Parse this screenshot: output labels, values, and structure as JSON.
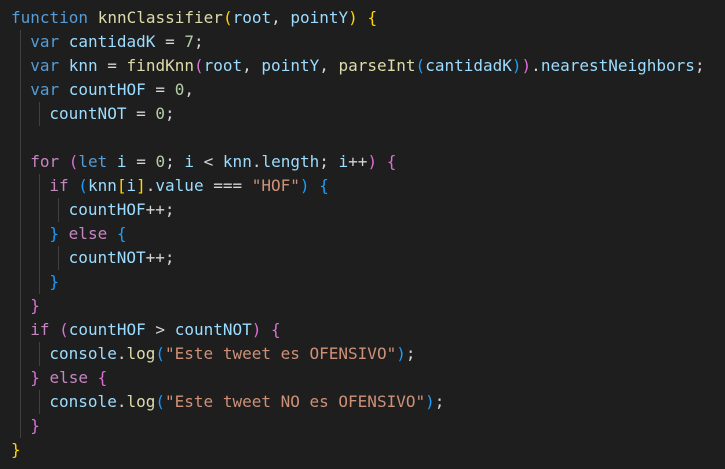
{
  "editor": {
    "language": "javascript",
    "theme_background": "#1e1e1e",
    "colors": {
      "keyword": "#569cd6",
      "control": "#c586c0",
      "function": "#dcdcaa",
      "variable": "#9cdcfe",
      "number": "#b5cea8",
      "string": "#ce9178",
      "bracket_level_1": "#ffd700",
      "bracket_level_2": "#da70d6",
      "bracket_level_3": "#179fff"
    },
    "lines": [
      {
        "indent": 0,
        "tokens": [
          {
            "t": "function",
            "c": "kw"
          },
          {
            "t": " ",
            "c": "plain"
          },
          {
            "t": "knnClassifier",
            "c": "fn"
          },
          {
            "t": "(",
            "c": "p1"
          },
          {
            "t": "root",
            "c": "var"
          },
          {
            "t": ", ",
            "c": "plain"
          },
          {
            "t": "pointY",
            "c": "var"
          },
          {
            "t": ")",
            "c": "p1"
          },
          {
            "t": " ",
            "c": "plain"
          },
          {
            "t": "{",
            "c": "p1"
          }
        ]
      },
      {
        "indent": 1,
        "tokens": [
          {
            "t": "var",
            "c": "kw"
          },
          {
            "t": " ",
            "c": "plain"
          },
          {
            "t": "cantidadK",
            "c": "var"
          },
          {
            "t": " = ",
            "c": "plain"
          },
          {
            "t": "7",
            "c": "num"
          },
          {
            "t": ";",
            "c": "plain"
          }
        ]
      },
      {
        "indent": 1,
        "tokens": [
          {
            "t": "var",
            "c": "kw"
          },
          {
            "t": " ",
            "c": "plain"
          },
          {
            "t": "knn",
            "c": "var"
          },
          {
            "t": " = ",
            "c": "plain"
          },
          {
            "t": "findKnn",
            "c": "fn"
          },
          {
            "t": "(",
            "c": "p2"
          },
          {
            "t": "root",
            "c": "var"
          },
          {
            "t": ", ",
            "c": "plain"
          },
          {
            "t": "pointY",
            "c": "var"
          },
          {
            "t": ", ",
            "c": "plain"
          },
          {
            "t": "parseInt",
            "c": "fn"
          },
          {
            "t": "(",
            "c": "p3"
          },
          {
            "t": "cantidadK",
            "c": "var"
          },
          {
            "t": ")",
            "c": "p3"
          },
          {
            "t": ")",
            "c": "p2"
          },
          {
            "t": ".",
            "c": "plain"
          },
          {
            "t": "nearestNeighbors",
            "c": "var"
          },
          {
            "t": ";",
            "c": "plain"
          }
        ]
      },
      {
        "indent": 1,
        "tokens": [
          {
            "t": "var",
            "c": "kw"
          },
          {
            "t": " ",
            "c": "plain"
          },
          {
            "t": "countHOF",
            "c": "var"
          },
          {
            "t": " = ",
            "c": "plain"
          },
          {
            "t": "0",
            "c": "num"
          },
          {
            "t": ",",
            "c": "plain"
          }
        ]
      },
      {
        "indent": 2,
        "tokens": [
          {
            "t": "countNOT",
            "c": "var"
          },
          {
            "t": " = ",
            "c": "plain"
          },
          {
            "t": "0",
            "c": "num"
          },
          {
            "t": ";",
            "c": "plain"
          }
        ]
      },
      {
        "indent": 1,
        "tokens": []
      },
      {
        "indent": 1,
        "tokens": [
          {
            "t": "for",
            "c": "ctl"
          },
          {
            "t": " ",
            "c": "plain"
          },
          {
            "t": "(",
            "c": "p2"
          },
          {
            "t": "let",
            "c": "kw"
          },
          {
            "t": " ",
            "c": "plain"
          },
          {
            "t": "i",
            "c": "var"
          },
          {
            "t": " = ",
            "c": "plain"
          },
          {
            "t": "0",
            "c": "num"
          },
          {
            "t": "; ",
            "c": "plain"
          },
          {
            "t": "i",
            "c": "var"
          },
          {
            "t": " < ",
            "c": "plain"
          },
          {
            "t": "knn",
            "c": "var"
          },
          {
            "t": ".",
            "c": "plain"
          },
          {
            "t": "length",
            "c": "var"
          },
          {
            "t": "; ",
            "c": "plain"
          },
          {
            "t": "i",
            "c": "var"
          },
          {
            "t": "++",
            "c": "plain"
          },
          {
            "t": ")",
            "c": "p2"
          },
          {
            "t": " ",
            "c": "plain"
          },
          {
            "t": "{",
            "c": "p2"
          }
        ]
      },
      {
        "indent": 2,
        "tokens": [
          {
            "t": "if",
            "c": "ctl"
          },
          {
            "t": " ",
            "c": "plain"
          },
          {
            "t": "(",
            "c": "p3"
          },
          {
            "t": "knn",
            "c": "var"
          },
          {
            "t": "[",
            "c": "p1"
          },
          {
            "t": "i",
            "c": "var"
          },
          {
            "t": "]",
            "c": "p1"
          },
          {
            "t": ".",
            "c": "plain"
          },
          {
            "t": "value",
            "c": "var"
          },
          {
            "t": " === ",
            "c": "plain"
          },
          {
            "t": "\"HOF\"",
            "c": "str"
          },
          {
            "t": ")",
            "c": "p3"
          },
          {
            "t": " ",
            "c": "plain"
          },
          {
            "t": "{",
            "c": "p3"
          }
        ]
      },
      {
        "indent": 3,
        "tokens": [
          {
            "t": "countHOF",
            "c": "var"
          },
          {
            "t": "++;",
            "c": "plain"
          }
        ]
      },
      {
        "indent": 2,
        "tokens": [
          {
            "t": "}",
            "c": "p3"
          },
          {
            "t": " ",
            "c": "plain"
          },
          {
            "t": "else",
            "c": "ctl"
          },
          {
            "t": " ",
            "c": "plain"
          },
          {
            "t": "{",
            "c": "p3"
          }
        ]
      },
      {
        "indent": 3,
        "tokens": [
          {
            "t": "countNOT",
            "c": "var"
          },
          {
            "t": "++;",
            "c": "plain"
          }
        ]
      },
      {
        "indent": 2,
        "tokens": [
          {
            "t": "}",
            "c": "p3"
          }
        ]
      },
      {
        "indent": 1,
        "tokens": [
          {
            "t": "}",
            "c": "p2"
          }
        ]
      },
      {
        "indent": 1,
        "tokens": [
          {
            "t": "if",
            "c": "ctl"
          },
          {
            "t": " ",
            "c": "plain"
          },
          {
            "t": "(",
            "c": "p2"
          },
          {
            "t": "countHOF",
            "c": "var"
          },
          {
            "t": " > ",
            "c": "plain"
          },
          {
            "t": "countNOT",
            "c": "var"
          },
          {
            "t": ")",
            "c": "p2"
          },
          {
            "t": " ",
            "c": "plain"
          },
          {
            "t": "{",
            "c": "p2"
          }
        ]
      },
      {
        "indent": 2,
        "tokens": [
          {
            "t": "console",
            "c": "var"
          },
          {
            "t": ".",
            "c": "plain"
          },
          {
            "t": "log",
            "c": "fn"
          },
          {
            "t": "(",
            "c": "p3"
          },
          {
            "t": "\"Este tweet es OFENSIVO\"",
            "c": "str"
          },
          {
            "t": ")",
            "c": "p3"
          },
          {
            "t": ";",
            "c": "plain"
          }
        ]
      },
      {
        "indent": 1,
        "tokens": [
          {
            "t": "}",
            "c": "p2"
          },
          {
            "t": " ",
            "c": "plain"
          },
          {
            "t": "else",
            "c": "ctl"
          },
          {
            "t": " ",
            "c": "plain"
          },
          {
            "t": "{",
            "c": "p2"
          }
        ]
      },
      {
        "indent": 2,
        "tokens": [
          {
            "t": "console",
            "c": "var"
          },
          {
            "t": ".",
            "c": "plain"
          },
          {
            "t": "log",
            "c": "fn"
          },
          {
            "t": "(",
            "c": "p3"
          },
          {
            "t": "\"Este tweet NO es OFENSIVO\"",
            "c": "str"
          },
          {
            "t": ")",
            "c": "p3"
          },
          {
            "t": ";",
            "c": "plain"
          }
        ]
      },
      {
        "indent": 1,
        "tokens": [
          {
            "t": "}",
            "c": "p2"
          }
        ]
      },
      {
        "indent": 0,
        "tokens": [
          {
            "t": "}",
            "c": "p1"
          }
        ]
      }
    ]
  }
}
